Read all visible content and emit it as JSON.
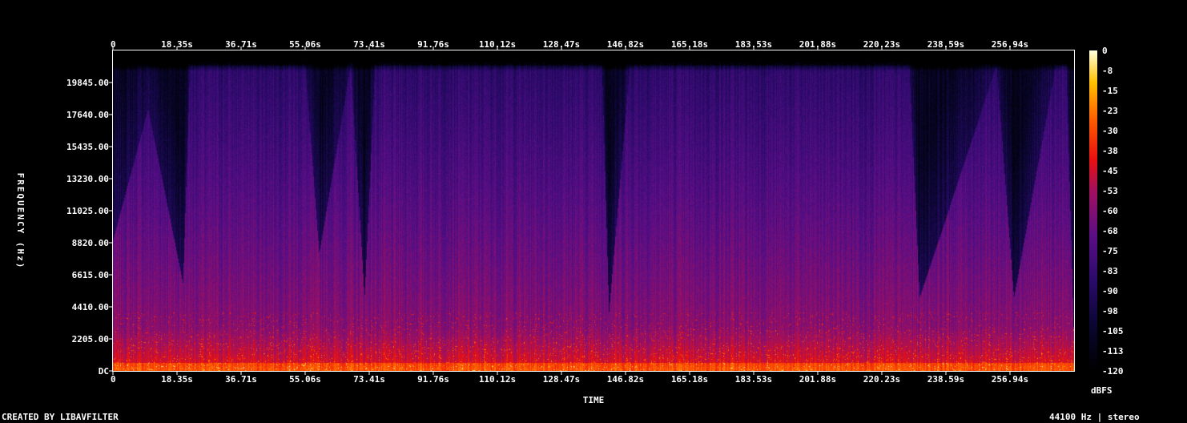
{
  "chart_data": {
    "type": "heatmap",
    "title": "",
    "xlabel": "TIME",
    "ylabel": "FREQUENCY (Hz)",
    "x_ticks": [
      "0",
      "18.35s",
      "36.71s",
      "55.06s",
      "73.41s",
      "91.76s",
      "110.12s",
      "128.47s",
      "146.82s",
      "165.18s",
      "183.53s",
      "201.88s",
      "220.23s",
      "238.59s",
      "256.94s"
    ],
    "x_range_seconds": [
      0,
      275.3
    ],
    "y_ticks": [
      "DC",
      "2205.00",
      "4410.00",
      "6615.00",
      "8820.00",
      "11025.00",
      "13230.00",
      "15435.00",
      "17640.00",
      "19845.00"
    ],
    "y_range_hz": [
      0,
      22050
    ],
    "colorbar": {
      "label": "dBFS",
      "ticks": [
        "0",
        "-8",
        "-15",
        "-23",
        "-30",
        "-38",
        "-45",
        "-53",
        "-60",
        "-68",
        "-75",
        "-83",
        "-90",
        "-98",
        "-105",
        "-113",
        "-120"
      ],
      "range_db": [
        -120,
        0
      ]
    },
    "intensity_profile": {
      "time_breakpoints_s": [
        0,
        10,
        20,
        22,
        55,
        59,
        68,
        72,
        75,
        100,
        108,
        140,
        142,
        148,
        210,
        220,
        228,
        231,
        253,
        258,
        270,
        273,
        275.3
      ],
      "bandwidth_hz": [
        9000,
        18000,
        6000,
        21000,
        21000,
        8000,
        21000,
        5000,
        21000,
        21000,
        21000,
        21000,
        4000,
        21000,
        21000,
        21000,
        21000,
        5000,
        21000,
        5000,
        21000,
        21000,
        1000
      ]
    },
    "grid": false,
    "legend": "right"
  },
  "footer": {
    "credit": "CREATED BY LIBAVFILTER",
    "sample_rate": "44100 Hz | stereo"
  }
}
